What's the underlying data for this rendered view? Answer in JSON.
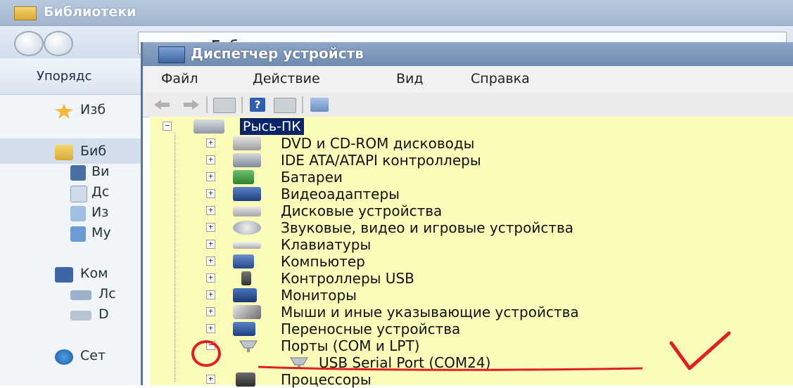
{
  "explorer": {
    "title": "Библиотеки",
    "address": "▾ Библиотеки ▾",
    "organize": "Упорядс",
    "nav_items": [
      {
        "label": "Изб",
        "icon": "star-icon"
      },
      {
        "label": "Биб",
        "icon": "libraries-icon"
      },
      {
        "label": "Ви",
        "icon": "video-icon"
      },
      {
        "label": "Дс",
        "icon": "documents-icon"
      },
      {
        "label": "Из",
        "icon": "images-icon"
      },
      {
        "label": "Му",
        "icon": "music-icon"
      },
      {
        "label": "Ком",
        "icon": "computer-icon"
      },
      {
        "label": "Лс",
        "icon": "disk-icon"
      },
      {
        "label": "D",
        "icon": "drive-icon"
      },
      {
        "label": "Сет",
        "icon": "network-icon"
      }
    ]
  },
  "device_manager": {
    "title": "Диспетчер устройств",
    "menu": [
      "Файл",
      "Действие",
      "Вид",
      "Справка"
    ],
    "root": "Рысь-ПК",
    "devices": [
      {
        "label": "DVD и CD-ROM дисководы",
        "icon": "dvd-drive-icon",
        "expander": "+"
      },
      {
        "label": "IDE ATA/ATAPI контроллеры",
        "icon": "ide-controller-icon",
        "expander": "+"
      },
      {
        "label": "Батареи",
        "icon": "battery-icon",
        "expander": "+"
      },
      {
        "label": "Видеоадаптеры",
        "icon": "display-adapter-icon",
        "expander": "+"
      },
      {
        "label": "Дисковые устройства",
        "icon": "disk-drive-icon",
        "expander": "+"
      },
      {
        "label": "Звуковые, видео и игровые устройства",
        "icon": "sound-device-icon",
        "expander": "+"
      },
      {
        "label": "Клавиатуры",
        "icon": "keyboard-icon",
        "expander": "+"
      },
      {
        "label": "Компьютер",
        "icon": "computer-icon",
        "expander": "+"
      },
      {
        "label": "Контроллеры USB",
        "icon": "usb-controller-icon",
        "expander": "+"
      },
      {
        "label": "Мониторы",
        "icon": "monitor-icon",
        "expander": "+"
      },
      {
        "label": "Мыши и иные указывающие устройства",
        "icon": "mouse-icon",
        "expander": "+"
      },
      {
        "label": "Переносные устройства",
        "icon": "portable-device-icon",
        "expander": "+"
      },
      {
        "label": "Порты (COM и LPT)",
        "icon": "port-icon",
        "expander": "−"
      },
      {
        "label": "USB Serial Port (COM24)",
        "icon": "port-icon",
        "expander": ""
      },
      {
        "label": "Процессоры",
        "icon": "processor-icon",
        "expander": "+"
      }
    ]
  },
  "colors": {
    "tree_background": "#fcfcba",
    "selection": "#0a246a",
    "annotation": "#e02020"
  }
}
